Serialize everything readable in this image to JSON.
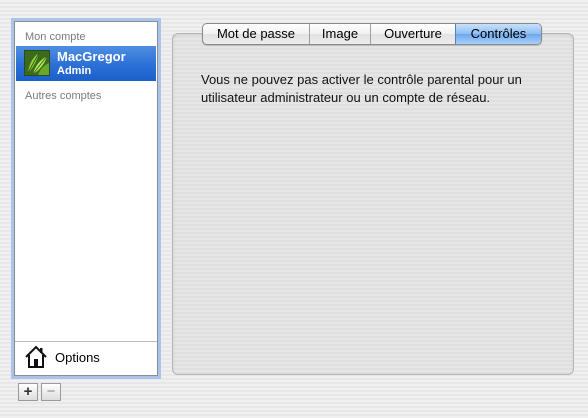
{
  "sidebar": {
    "my_account_header": "Mon compte",
    "account": {
      "name": "MacGregor",
      "role": "Admin"
    },
    "other_accounts_header": "Autres comptes",
    "options_label": "Options"
  },
  "buttons": {
    "add": "+",
    "remove": "−"
  },
  "tabs": [
    {
      "label": "Mot de passe",
      "selected": false
    },
    {
      "label": "Image",
      "selected": false
    },
    {
      "label": "Ouverture",
      "selected": false
    },
    {
      "label": "Contrôles",
      "selected": true
    }
  ],
  "panel": {
    "message": "Vous ne pouvez pas activer le contrôle parental pour un utilisateur administrateur ou un compte de réseau."
  },
  "colors": {
    "selection": "#2c6fd6",
    "selected_tab": "#8ebdf3",
    "focus_ring": "#a9c4e8"
  },
  "icons": {
    "options": "home-icon",
    "avatar": "leaf-avatar"
  }
}
